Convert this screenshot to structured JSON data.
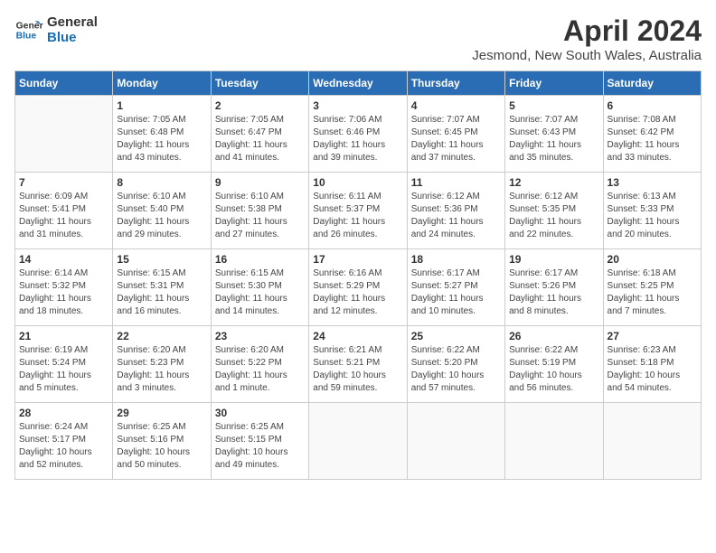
{
  "header": {
    "logo_line1": "General",
    "logo_line2": "Blue",
    "month": "April 2024",
    "location": "Jesmond, New South Wales, Australia"
  },
  "weekdays": [
    "Sunday",
    "Monday",
    "Tuesday",
    "Wednesday",
    "Thursday",
    "Friday",
    "Saturday"
  ],
  "weeks": [
    [
      {
        "day": "",
        "info": ""
      },
      {
        "day": "1",
        "info": "Sunrise: 7:05 AM\nSunset: 6:48 PM\nDaylight: 11 hours\nand 43 minutes."
      },
      {
        "day": "2",
        "info": "Sunrise: 7:05 AM\nSunset: 6:47 PM\nDaylight: 11 hours\nand 41 minutes."
      },
      {
        "day": "3",
        "info": "Sunrise: 7:06 AM\nSunset: 6:46 PM\nDaylight: 11 hours\nand 39 minutes."
      },
      {
        "day": "4",
        "info": "Sunrise: 7:07 AM\nSunset: 6:45 PM\nDaylight: 11 hours\nand 37 minutes."
      },
      {
        "day": "5",
        "info": "Sunrise: 7:07 AM\nSunset: 6:43 PM\nDaylight: 11 hours\nand 35 minutes."
      },
      {
        "day": "6",
        "info": "Sunrise: 7:08 AM\nSunset: 6:42 PM\nDaylight: 11 hours\nand 33 minutes."
      }
    ],
    [
      {
        "day": "7",
        "info": "Sunrise: 6:09 AM\nSunset: 5:41 PM\nDaylight: 11 hours\nand 31 minutes."
      },
      {
        "day": "8",
        "info": "Sunrise: 6:10 AM\nSunset: 5:40 PM\nDaylight: 11 hours\nand 29 minutes."
      },
      {
        "day": "9",
        "info": "Sunrise: 6:10 AM\nSunset: 5:38 PM\nDaylight: 11 hours\nand 27 minutes."
      },
      {
        "day": "10",
        "info": "Sunrise: 6:11 AM\nSunset: 5:37 PM\nDaylight: 11 hours\nand 26 minutes."
      },
      {
        "day": "11",
        "info": "Sunrise: 6:12 AM\nSunset: 5:36 PM\nDaylight: 11 hours\nand 24 minutes."
      },
      {
        "day": "12",
        "info": "Sunrise: 6:12 AM\nSunset: 5:35 PM\nDaylight: 11 hours\nand 22 minutes."
      },
      {
        "day": "13",
        "info": "Sunrise: 6:13 AM\nSunset: 5:33 PM\nDaylight: 11 hours\nand 20 minutes."
      }
    ],
    [
      {
        "day": "14",
        "info": "Sunrise: 6:14 AM\nSunset: 5:32 PM\nDaylight: 11 hours\nand 18 minutes."
      },
      {
        "day": "15",
        "info": "Sunrise: 6:15 AM\nSunset: 5:31 PM\nDaylight: 11 hours\nand 16 minutes."
      },
      {
        "day": "16",
        "info": "Sunrise: 6:15 AM\nSunset: 5:30 PM\nDaylight: 11 hours\nand 14 minutes."
      },
      {
        "day": "17",
        "info": "Sunrise: 6:16 AM\nSunset: 5:29 PM\nDaylight: 11 hours\nand 12 minutes."
      },
      {
        "day": "18",
        "info": "Sunrise: 6:17 AM\nSunset: 5:27 PM\nDaylight: 11 hours\nand 10 minutes."
      },
      {
        "day": "19",
        "info": "Sunrise: 6:17 AM\nSunset: 5:26 PM\nDaylight: 11 hours\nand 8 minutes."
      },
      {
        "day": "20",
        "info": "Sunrise: 6:18 AM\nSunset: 5:25 PM\nDaylight: 11 hours\nand 7 minutes."
      }
    ],
    [
      {
        "day": "21",
        "info": "Sunrise: 6:19 AM\nSunset: 5:24 PM\nDaylight: 11 hours\nand 5 minutes."
      },
      {
        "day": "22",
        "info": "Sunrise: 6:20 AM\nSunset: 5:23 PM\nDaylight: 11 hours\nand 3 minutes."
      },
      {
        "day": "23",
        "info": "Sunrise: 6:20 AM\nSunset: 5:22 PM\nDaylight: 11 hours\nand 1 minute."
      },
      {
        "day": "24",
        "info": "Sunrise: 6:21 AM\nSunset: 5:21 PM\nDaylight: 10 hours\nand 59 minutes."
      },
      {
        "day": "25",
        "info": "Sunrise: 6:22 AM\nSunset: 5:20 PM\nDaylight: 10 hours\nand 57 minutes."
      },
      {
        "day": "26",
        "info": "Sunrise: 6:22 AM\nSunset: 5:19 PM\nDaylight: 10 hours\nand 56 minutes."
      },
      {
        "day": "27",
        "info": "Sunrise: 6:23 AM\nSunset: 5:18 PM\nDaylight: 10 hours\nand 54 minutes."
      }
    ],
    [
      {
        "day": "28",
        "info": "Sunrise: 6:24 AM\nSunset: 5:17 PM\nDaylight: 10 hours\nand 52 minutes."
      },
      {
        "day": "29",
        "info": "Sunrise: 6:25 AM\nSunset: 5:16 PM\nDaylight: 10 hours\nand 50 minutes."
      },
      {
        "day": "30",
        "info": "Sunrise: 6:25 AM\nSunset: 5:15 PM\nDaylight: 10 hours\nand 49 minutes."
      },
      {
        "day": "",
        "info": ""
      },
      {
        "day": "",
        "info": ""
      },
      {
        "day": "",
        "info": ""
      },
      {
        "day": "",
        "info": ""
      }
    ]
  ]
}
